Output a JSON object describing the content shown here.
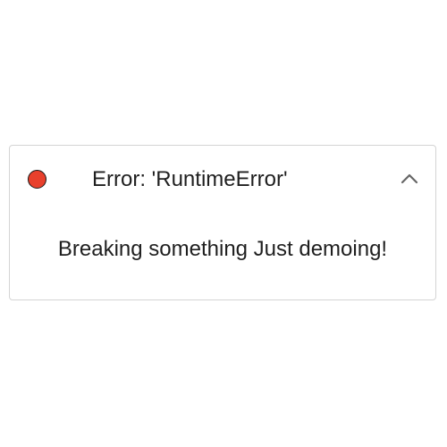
{
  "error_panel": {
    "status_color": "#e8402c",
    "title": "Error: 'RuntimeError'",
    "toggle_icon": "chevron-up-icon",
    "expanded": true,
    "message": "Breaking something Just demoing!"
  }
}
